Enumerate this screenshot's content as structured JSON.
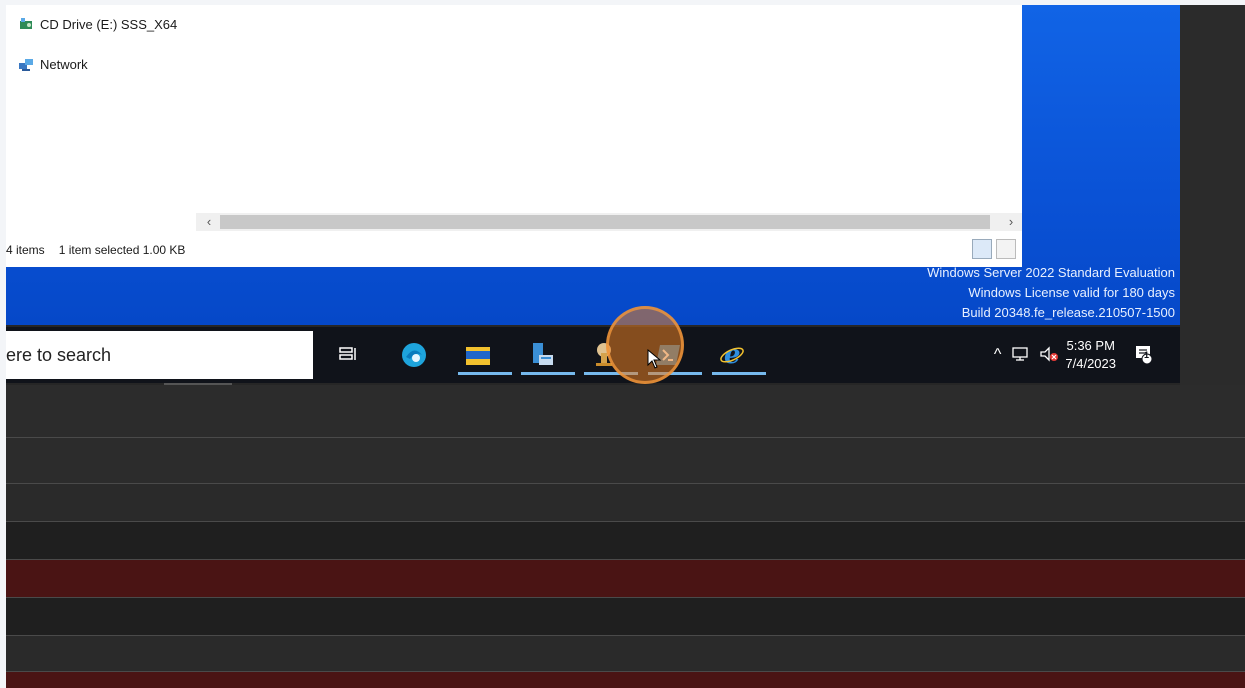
{
  "explorer": {
    "nav_items": [
      {
        "label": "CD Drive (E:) SSS_X64",
        "icon": "cd-drive-icon"
      },
      {
        "label": "Network",
        "icon": "network-icon"
      }
    ],
    "status": {
      "item_count": "4 items",
      "selection": "1 item selected  1.00 KB"
    }
  },
  "watermark": {
    "line1": "Windows Server 2022 Standard Evaluation",
    "line2": "Windows License valid for 180 days",
    "line3": "Build 20348.fe_release.210507-1500"
  },
  "taskbar": {
    "search_text": "ere to search",
    "apps": [
      "task-view-icon",
      "edge-icon",
      "file-explorer-icon",
      "server-manager-icon",
      "admin-tools-icon",
      "powershell-icon",
      "internet-explorer-icon"
    ],
    "clock_time": "5:36 PM",
    "clock_date": "7/4/2023",
    "notification_count": "1"
  },
  "colors": {
    "desktop": "#0a52d6",
    "taskbar": "#10131a",
    "accent": "#76b9ed",
    "highlight_row": "#4a1414"
  }
}
